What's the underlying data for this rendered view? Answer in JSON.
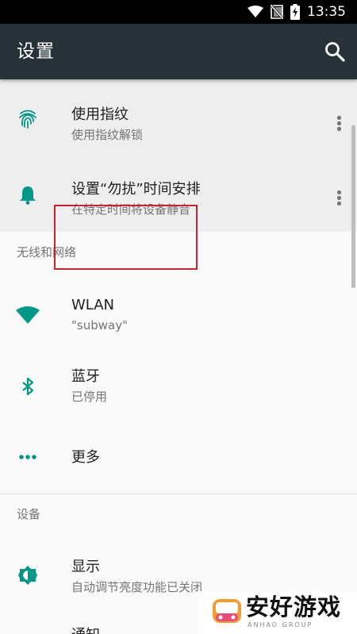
{
  "status_bar": {
    "time": "13:35",
    "icons": [
      "wifi-signal-icon",
      "no-sim-icon",
      "battery-charging-icon"
    ]
  },
  "toolbar": {
    "title": "设置",
    "search_icon": "search-icon"
  },
  "suggestions": [
    {
      "icon": "fingerprint-icon",
      "title": "使用指纹",
      "subtitle": "使用指纹解锁"
    },
    {
      "icon": "bell-icon",
      "title": "设置“勿扰”时间安排",
      "subtitle": "在特定时间将设备静音"
    }
  ],
  "sections": [
    {
      "header": "无线和网络",
      "items": [
        {
          "icon": "wifi-icon",
          "title": "WLAN",
          "subtitle": "\"subway\""
        },
        {
          "icon": "bluetooth-icon",
          "title": "蓝牙",
          "subtitle": "已停用"
        },
        {
          "icon": "more-horiz-icon",
          "title": "更多"
        }
      ]
    },
    {
      "header": "设备",
      "items": [
        {
          "icon": "brightness-icon",
          "title": "显示",
          "subtitle": "自动调节亮度功能已关闭"
        },
        {
          "icon": "notification-icon",
          "title": "通知"
        }
      ]
    }
  ],
  "watermark": {
    "text": "安好游戏",
    "subtext": "ANHAO GROUP"
  },
  "colors": {
    "accent": "#009688",
    "toolbar": "#263238",
    "highlight": "#c0282d"
  }
}
